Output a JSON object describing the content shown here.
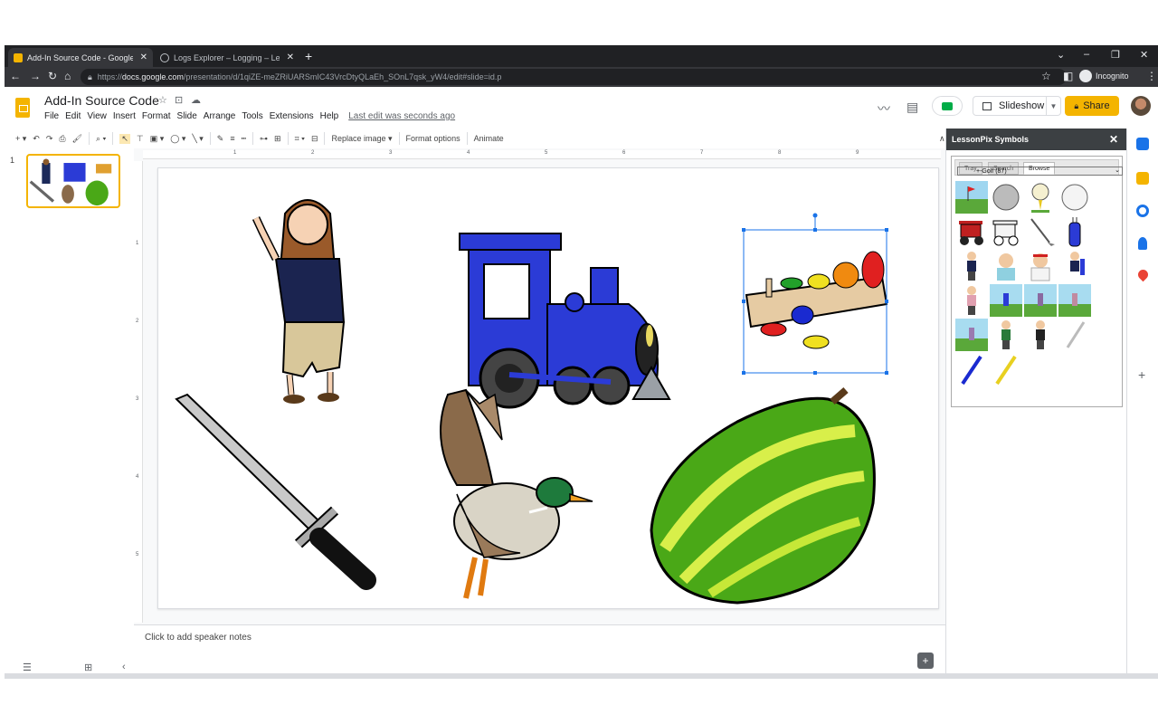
{
  "tabs": [
    {
      "label": "Add-In Source Code - Google Sli",
      "active": true
    },
    {
      "label": "Logs Explorer – Logging – Lesso",
      "active": false
    }
  ],
  "address": {
    "prefix": "https://",
    "host": "docs.google.com",
    "path": "/presentation/d/1qiZE-meZRiUARSmIC43VrcDtyQLaEh_SOnL7qsk_yW4/edit#slide=id.p",
    "incognito_label": "Incognito"
  },
  "doc": {
    "title": "Add-In Source Code",
    "menus": [
      "File",
      "Edit",
      "View",
      "Insert",
      "Format",
      "Slide",
      "Arrange",
      "Tools",
      "Extensions",
      "Help"
    ],
    "last_edit": "Last edit was seconds ago",
    "slideshow_label": "Slideshow",
    "share_label": "Share"
  },
  "toolbar": {
    "replace_image": "Replace image ▾",
    "format_options": "Format options",
    "animate": "Animate"
  },
  "filmstrip": {
    "slide_number": "1"
  },
  "ruler": {
    "h_numbers": [
      "1",
      "2",
      "3",
      "4",
      "5",
      "6",
      "7",
      "8",
      "9"
    ],
    "v_numbers": [
      "1",
      "2",
      "3",
      "4",
      "5"
    ]
  },
  "notes": {
    "placeholder": "Click to add speaker notes"
  },
  "addon": {
    "title": "LessonPix Symbols",
    "tabs": [
      "Tray",
      "Search",
      "Browse"
    ],
    "active_tab": "Browse",
    "category": "+-Golf (87)",
    "picture_icons": [
      "golf-green",
      "golf-ball",
      "golf-ball-on-tee",
      "golf-ball-white",
      "golf-cart-red",
      "golf-cart-white",
      "golf-club",
      "golf-bag",
      "golfer-with-bag",
      "golfer-visor",
      "golfer-red-cap",
      "golfer-bag-blue",
      "golfer-pink",
      "golfer-swing-1",
      "golfer-swing-2",
      "golfer-swing-3",
      "golfer-swing-4",
      "golfer-walking",
      "golfer-carrying",
      "golf-tee-white",
      "golf-tee-blue",
      "golf-tee-yellow"
    ]
  },
  "colors": {
    "slides_brand": "#f4b400",
    "selection": "#1a73e8",
    "train_blue": "#2b3bd6",
    "duck_green": "#1e7a3c",
    "gourd_green": "#4aa817"
  }
}
